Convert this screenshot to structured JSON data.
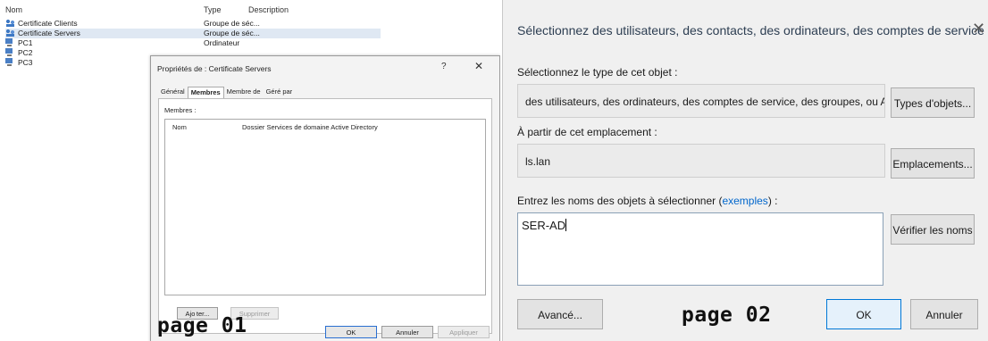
{
  "left_panel": {
    "columns": [
      "Nom",
      "Type",
      "Description"
    ],
    "rows": [
      {
        "name": "Certificate Clients",
        "type": "Groupe de séc...",
        "icon": "group-icon",
        "selected": false
      },
      {
        "name": "Certificate Servers",
        "type": "Groupe de séc...",
        "icon": "group-icon",
        "selected": true
      },
      {
        "name": "PC1",
        "type": "Ordinateur",
        "icon": "computer-icon",
        "selected": false
      },
      {
        "name": "PC2",
        "type": "",
        "icon": "computer-icon",
        "selected": false
      },
      {
        "name": "PC3",
        "type": "",
        "icon": "computer-icon",
        "selected": false
      }
    ],
    "dialog": {
      "title": "Propriétés de : Certificate Servers",
      "help": "?",
      "close": "✕",
      "tabs": [
        "Général",
        "Membres",
        "Membre de",
        "Géré par"
      ],
      "active_tab": "Membres",
      "members_label": "Membres :",
      "member_columns": [
        "Nom",
        "Dossier Services de domaine Active Directory"
      ],
      "add_button": "Ajo ter...",
      "remove_button": "Supprimer",
      "ok_button": "OK",
      "cancel_button": "Annuler",
      "apply_button": "Appliquer"
    },
    "page_label": "page 01"
  },
  "right_panel": {
    "title": "Sélectionnez des utilisateurs, des contacts, des ordinateurs, des comptes de service ou des...",
    "close": "✕",
    "object_type_label": "Sélectionnez le type de cet objet :",
    "object_type_value": "des utilisateurs, des ordinateurs, des comptes de service, des groupes, ou Autres ol",
    "object_types_button": "Types d'objets...",
    "location_label": "À partir de cet emplacement :",
    "location_value": "ls.lan",
    "locations_button": "Emplacements...",
    "names_label_prefix": "Entrez les noms des objets à sélectionner (",
    "names_label_link": "exemples",
    "names_label_suffix": ") :",
    "names_value": "SER-AD",
    "check_names_button": "Vérifier les noms",
    "advanced_button": "Avancé...",
    "ok_button": "OK",
    "cancel_button": "Annuler",
    "page_label": "page 02"
  },
  "colors": {
    "selection": "#dfe8f3",
    "link": "#0066cc",
    "primary_border": "#0078d7",
    "title_text": "#2d3e52"
  }
}
